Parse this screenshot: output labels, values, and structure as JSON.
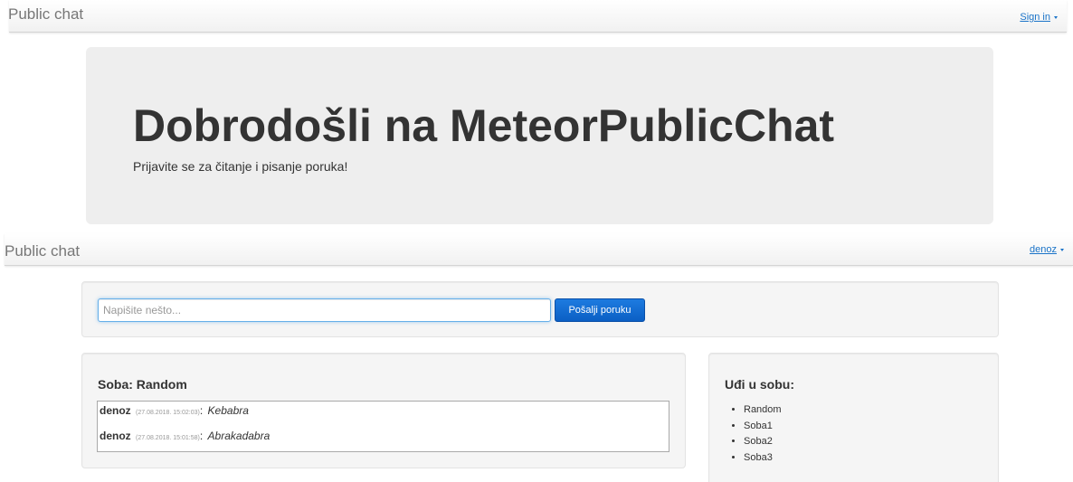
{
  "navbar_top": {
    "brand": "Public chat",
    "account_label": "Sign in"
  },
  "jumbotron": {
    "heading": "Dobrodošli na MeteorPublicChat",
    "subtext": "Prijavite se za čitanje i pisanje poruka!"
  },
  "navbar_second": {
    "brand": "Public chat",
    "account_label": "denoz"
  },
  "compose": {
    "placeholder": "Napišite nešto...",
    "value": "",
    "send_label": "Pošalji poruku"
  },
  "room": {
    "title": "Soba: Random",
    "messages": [
      {
        "user": "denoz",
        "time": "(27.08.2018. 15:02:03)",
        "separator": ":",
        "text": "Kebabra"
      },
      {
        "user": "denoz",
        "time": "(27.08.2018. 15:01:58)",
        "separator": ":",
        "text": "Abrakadabra"
      }
    ]
  },
  "rooms_panel": {
    "title": "Uđi u sobu:",
    "rooms": [
      "Random",
      "Soba1",
      "Soba2",
      "Soba3"
    ]
  },
  "colors": {
    "link": "#1a73c8",
    "primary_button": "#0b5fc4",
    "panel_background": "#f5f5f5",
    "jumbotron_background": "#eeeeee"
  }
}
